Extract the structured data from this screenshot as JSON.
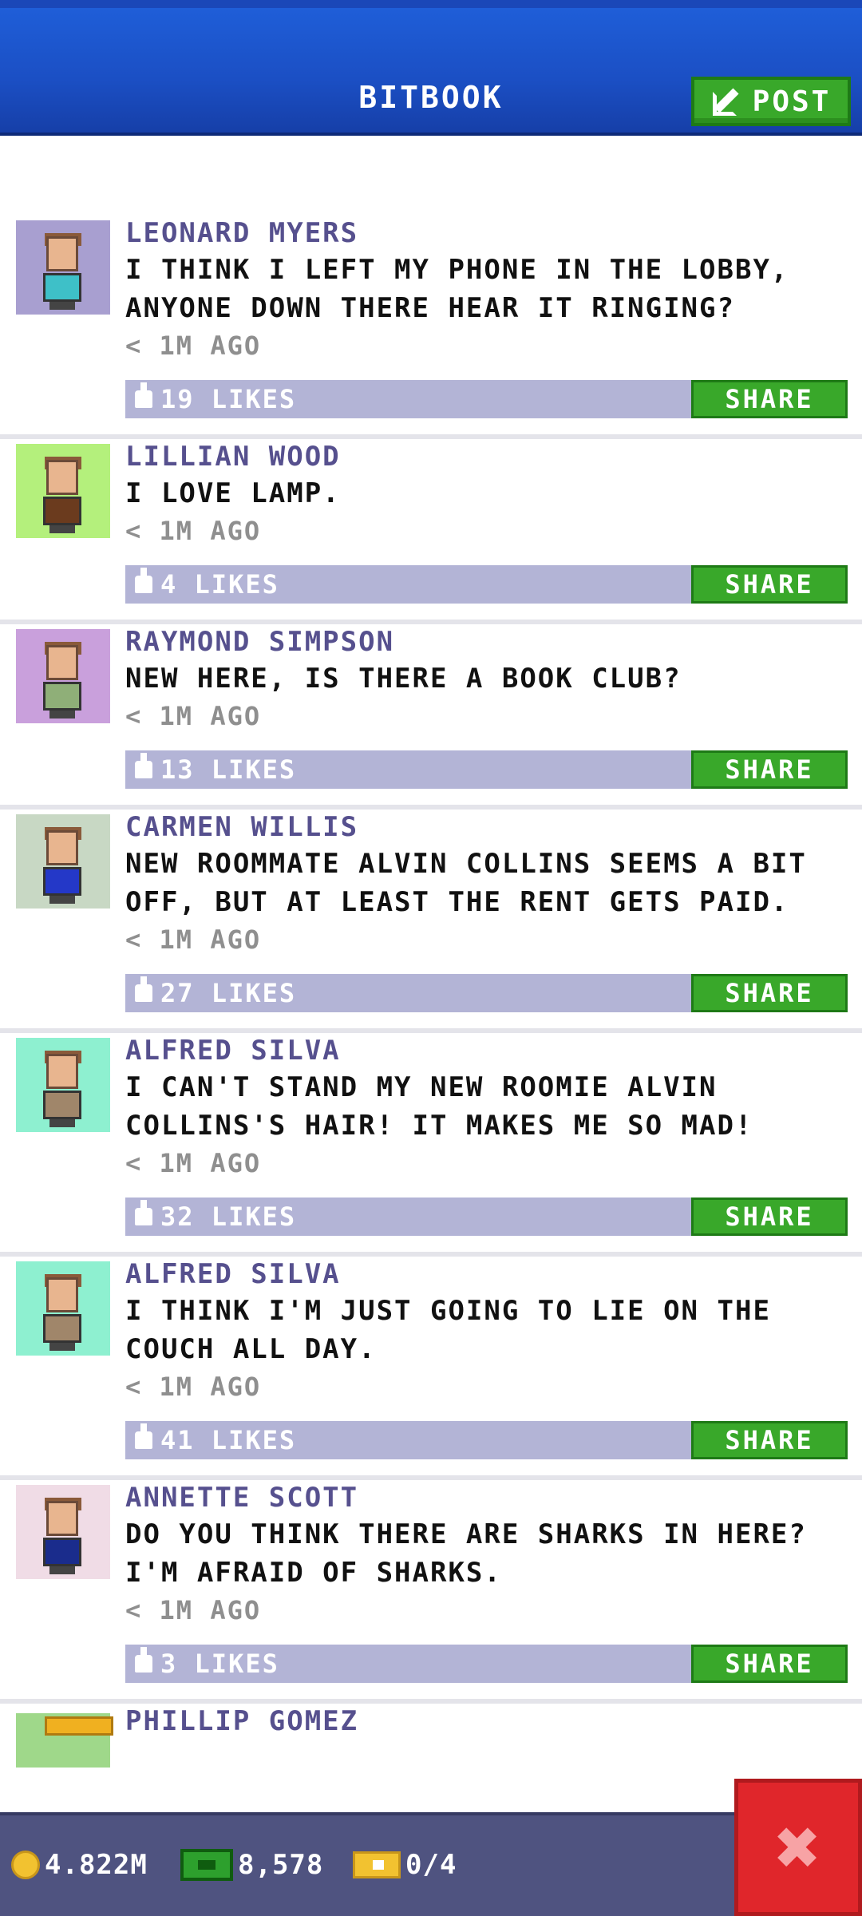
{
  "header": {
    "title": "BITBOOK",
    "post_label": "POST"
  },
  "posts": [
    {
      "author": "LEONARD MYERS",
      "lines": [
        "I THINK I LEFT MY PHONE IN THE LOBBY,",
        "ANYONE DOWN THERE HEAR IT RINGING?"
      ],
      "time": "< 1M AGO",
      "likes": "19 LIKES",
      "share": "SHARE",
      "avatar_bg": "#a89fd0",
      "shirt": "#3ec0c8"
    },
    {
      "author": "LILLIAN WOOD",
      "lines": [
        "I LOVE LAMP."
      ],
      "time": "< 1M AGO",
      "likes": "4 LIKES",
      "share": "SHARE",
      "avatar_bg": "#b4f07c",
      "shirt": "#6b3b1e"
    },
    {
      "author": "RAYMOND SIMPSON",
      "lines": [
        "NEW HERE, IS THERE A BOOK CLUB?"
      ],
      "time": "< 1M AGO",
      "likes": "13 LIKES",
      "share": "SHARE",
      "avatar_bg": "#c9a0dc",
      "shirt": "#8faf78"
    },
    {
      "author": "CARMEN WILLIS",
      "lines": [
        "NEW ROOMMATE ALVIN COLLINS SEEMS A BIT",
        "OFF, BUT AT LEAST THE RENT GETS PAID."
      ],
      "time": "< 1M AGO",
      "likes": "27 LIKES",
      "share": "SHARE",
      "avatar_bg": "#c8d8c4",
      "shirt": "#2438c8"
    },
    {
      "author": "ALFRED SILVA",
      "lines": [
        "I CAN'T STAND MY NEW ROOMIE ALVIN",
        "COLLINS'S HAIR! IT MAKES ME SO MAD!"
      ],
      "time": "< 1M AGO",
      "likes": "32 LIKES",
      "share": "SHARE",
      "avatar_bg": "#8ef0d0",
      "shirt": "#a0866a"
    },
    {
      "author": "ALFRED SILVA",
      "lines": [
        "I THINK I'M JUST GOING TO LIE ON THE",
        "COUCH ALL DAY."
      ],
      "time": "< 1M AGO",
      "likes": "41 LIKES",
      "share": "SHARE",
      "avatar_bg": "#8ef0d0",
      "shirt": "#a0866a"
    },
    {
      "author": "ANNETTE SCOTT",
      "lines": [
        "DO YOU THINK THERE ARE SHARKS IN HERE?",
        "I'M AFRAID OF SHARKS."
      ],
      "time": "< 1M AGO",
      "likes": "3 LIKES",
      "share": "SHARE",
      "avatar_bg": "#f0dce6",
      "shirt": "#1a2c8c"
    }
  ],
  "partial_post": {
    "author": "PHILLIP GOMEZ"
  },
  "footer": {
    "coins": "4.822M",
    "bux": "8,578",
    "tickets": "0/4"
  },
  "icons": {
    "post": "edit-icon",
    "like": "thumbs-up-icon",
    "coin": "coin-icon",
    "bux": "cash-icon",
    "ticket": "ticket-icon",
    "close": "close-icon"
  }
}
